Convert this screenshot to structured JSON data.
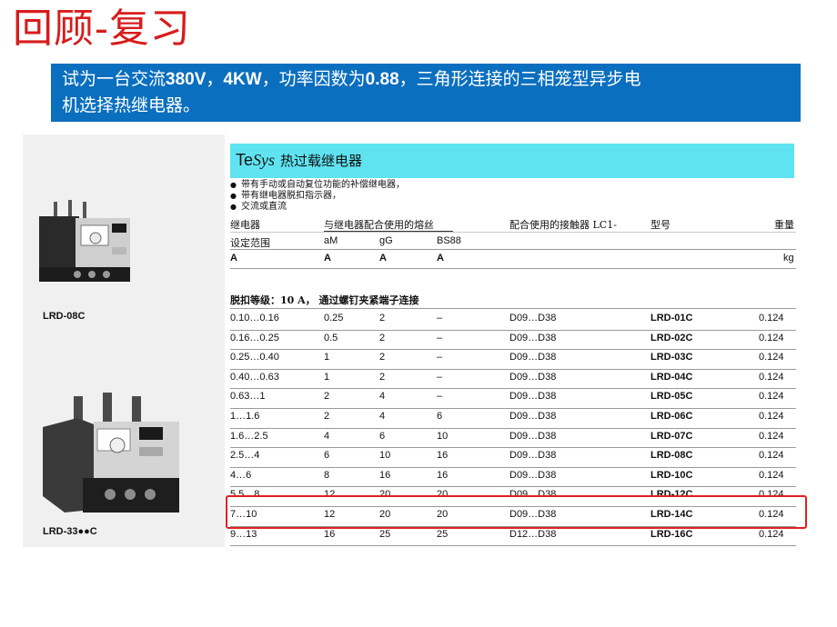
{
  "slide": {
    "title": "回顾-复习",
    "question": {
      "part1": "试为一台交流",
      "voltage": "380V",
      "sep1": "，",
      "power": "4KW",
      "part2": "，功率因数为",
      "pf": "0.88",
      "part3": "，三角形连接的三相笼型异步电",
      "part4": "机选择热继电器。"
    }
  },
  "catalog": {
    "brand_prefix": "Te",
    "brand_italic": "Sys",
    "brand_cn": "热过载继电器",
    "bullets": [
      "带有手动或自动复位功能的补偿继电器，",
      "带有继电器脱扣指示器，",
      "交流或直流"
    ],
    "products": [
      {
        "caption": "LRD-08C"
      },
      {
        "caption": "LRD-33●●C"
      }
    ],
    "headers": {
      "relay_line1": "继电器",
      "relay_line2": "设定范围",
      "fuse_group": "与继电器配合使用的熔丝",
      "fuse_cols": [
        "aM",
        "gG",
        "BS88"
      ],
      "contactor": "配合使用的接触器 LC1-",
      "model": "型号",
      "weight": "重量"
    },
    "units": {
      "range": "A",
      "am": "A",
      "gg": "A",
      "bs88": "A",
      "weight": "kg"
    },
    "trip_class": "脱扣等级：10 A， 通过螺钉夹紧端子连接",
    "rows": [
      {
        "range": "0.10…0.16",
        "am": "0.25",
        "gg": "2",
        "bs88": "–",
        "contactor": "D09…D38",
        "model": "LRD-01C",
        "weight": "0.124"
      },
      {
        "range": "0.16…0.25",
        "am": "0.5",
        "gg": "2",
        "bs88": "–",
        "contactor": "D09…D38",
        "model": "LRD-02C",
        "weight": "0.124"
      },
      {
        "range": "0.25…0.40",
        "am": "1",
        "gg": "2",
        "bs88": "–",
        "contactor": "D09…D38",
        "model": "LRD-03C",
        "weight": "0.124"
      },
      {
        "range": "0.40…0.63",
        "am": "1",
        "gg": "2",
        "bs88": "–",
        "contactor": "D09…D38",
        "model": "LRD-04C",
        "weight": "0.124"
      },
      {
        "range": "0.63…1",
        "am": "2",
        "gg": "4",
        "bs88": "–",
        "contactor": "D09…D38",
        "model": "LRD-05C",
        "weight": "0.124"
      },
      {
        "range": "1…1.6",
        "am": "2",
        "gg": "4",
        "bs88": "6",
        "contactor": "D09…D38",
        "model": "LRD-06C",
        "weight": "0.124"
      },
      {
        "range": "1.6…2.5",
        "am": "4",
        "gg": "6",
        "bs88": "10",
        "contactor": "D09…D38",
        "model": "LRD-07C",
        "weight": "0.124"
      },
      {
        "range": "2.5…4",
        "am": "6",
        "gg": "10",
        "bs88": "16",
        "contactor": "D09…D38",
        "model": "LRD-08C",
        "weight": "0.124"
      },
      {
        "range": "4…6",
        "am": "8",
        "gg": "16",
        "bs88": "16",
        "contactor": "D09…D38",
        "model": "LRD-10C",
        "weight": "0.124"
      },
      {
        "range": "5.5…8",
        "am": "12",
        "gg": "20",
        "bs88": "20",
        "contactor": "D09…D38",
        "model": "LRD-12C",
        "weight": "0.124"
      },
      {
        "range": "7…10",
        "am": "12",
        "gg": "20",
        "bs88": "20",
        "contactor": "D09…D38",
        "model": "LRD-14C",
        "weight": "0.124",
        "highlighted": true
      },
      {
        "range": "9…13",
        "am": "16",
        "gg": "25",
        "bs88": "25",
        "contactor": "D12…D38",
        "model": "LRD-16C",
        "weight": "0.124"
      }
    ],
    "highlight_color": "#e02020",
    "header_color": "#5fe3f1",
    "question_bg": "#0b6fbf",
    "title_color": "#d81c1c"
  }
}
